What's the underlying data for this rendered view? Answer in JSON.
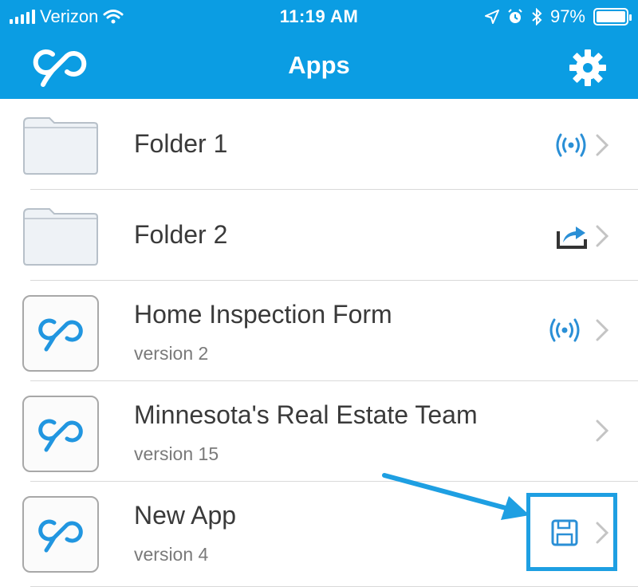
{
  "status_bar": {
    "carrier": "Verizon",
    "time": "11:19 AM",
    "battery": "97%"
  },
  "nav": {
    "title": "Apps"
  },
  "items": [
    {
      "title": "Folder 1",
      "subtitle": "",
      "kind": "folder",
      "status_icon": "broadcast-icon"
    },
    {
      "title": "Folder 2",
      "subtitle": "",
      "kind": "folder",
      "status_icon": "share-icon"
    },
    {
      "title": "Home Inspection Form",
      "subtitle": "version 2",
      "kind": "app",
      "status_icon": "broadcast-icon"
    },
    {
      "title": "Minnesota's Real Estate Team",
      "subtitle": "version 15",
      "kind": "app",
      "status_icon": ""
    },
    {
      "title": "New App",
      "subtitle": "version 4",
      "kind": "app",
      "status_icon": "save-icon"
    }
  ],
  "colors": {
    "brand": "#0b9de3",
    "accent_icon": "#2a8fd6",
    "highlight": "#1e9fe2"
  }
}
